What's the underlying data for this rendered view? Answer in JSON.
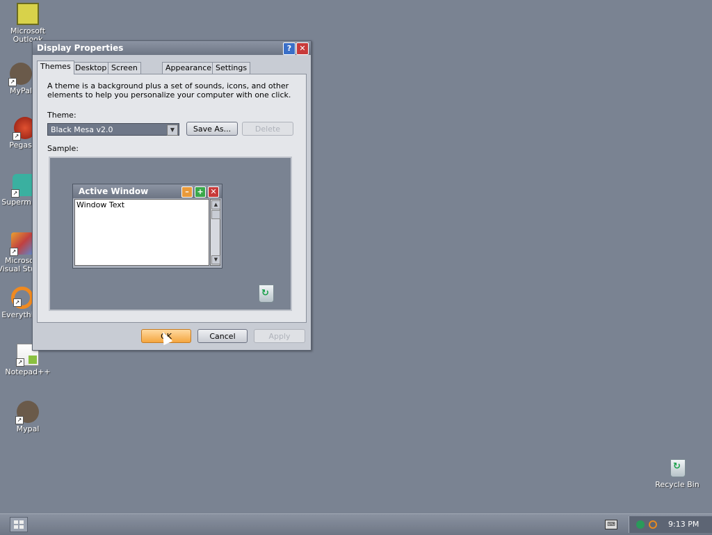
{
  "desktop": {
    "icons": [
      {
        "label": "Microsoft Outlook",
        "icon": "outlook-icon"
      },
      {
        "label": "MyPal",
        "icon": "mypal-icon"
      },
      {
        "label": "Pegasus",
        "icon": "pegasus-icon"
      },
      {
        "label": "Supermium",
        "icon": "supermium-icon"
      },
      {
        "label": "Microsoft Visual Studio",
        "icon": "visual-studio-icon"
      },
      {
        "label": "Everything",
        "icon": "everything-icon"
      },
      {
        "label": "Notepad++",
        "icon": "notepadpp-icon"
      },
      {
        "label": "Mypal",
        "icon": "mypal-icon"
      },
      {
        "label": "Recycle Bin",
        "icon": "recycle-bin-icon"
      }
    ]
  },
  "window": {
    "title": "Display Properties",
    "tabs": [
      "Themes",
      "Desktop",
      "Screen Saver",
      "Appearance",
      "Settings"
    ],
    "active_tab": "Themes",
    "description": "A theme is a background plus a set of sounds, icons, and other elements to help you personalize your computer with one click.",
    "theme_label": "Theme:",
    "theme_value": "Black Mesa v2.0",
    "save_as_label": "Save As...",
    "delete_label": "Delete",
    "sample_label": "Sample:",
    "sample_window_title": "Active Window",
    "sample_window_text": "Window Text",
    "ok_label": "OK",
    "cancel_label": "Cancel",
    "apply_label": "Apply"
  },
  "taskbar": {
    "clock": "9:13 PM"
  },
  "colors": {
    "desktop_bg": "#7a8392",
    "ok_button": "#f4a640"
  }
}
